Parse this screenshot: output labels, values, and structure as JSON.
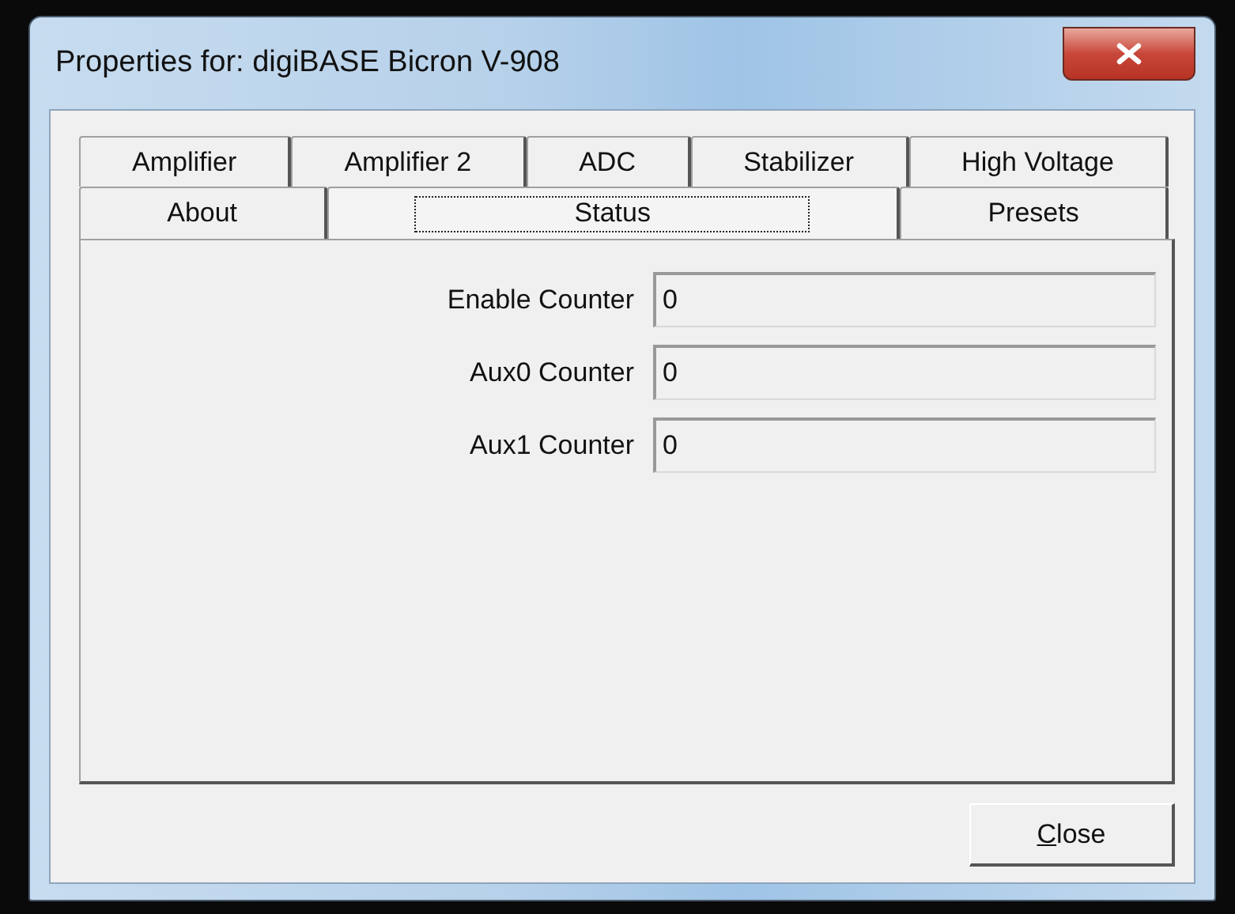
{
  "window": {
    "title": "Properties for: digiBASE Bicron V-908"
  },
  "tab_rows": [
    [
      {
        "label": "Amplifier",
        "selected": false
      },
      {
        "label": "Amplifier 2",
        "selected": false
      },
      {
        "label": "ADC",
        "selected": false
      },
      {
        "label": "Stabilizer",
        "selected": false
      },
      {
        "label": "High Voltage",
        "selected": false
      }
    ],
    [
      {
        "label": "About",
        "selected": false
      },
      {
        "label": "Status",
        "selected": true
      },
      {
        "label": "Presets",
        "selected": false
      }
    ]
  ],
  "fields": [
    {
      "label": "Enable Counter",
      "value": "0"
    },
    {
      "label": "Aux0 Counter",
      "value": "0"
    },
    {
      "label": "Aux1 Counter",
      "value": "0"
    }
  ],
  "buttons": [
    "Close"
  ]
}
